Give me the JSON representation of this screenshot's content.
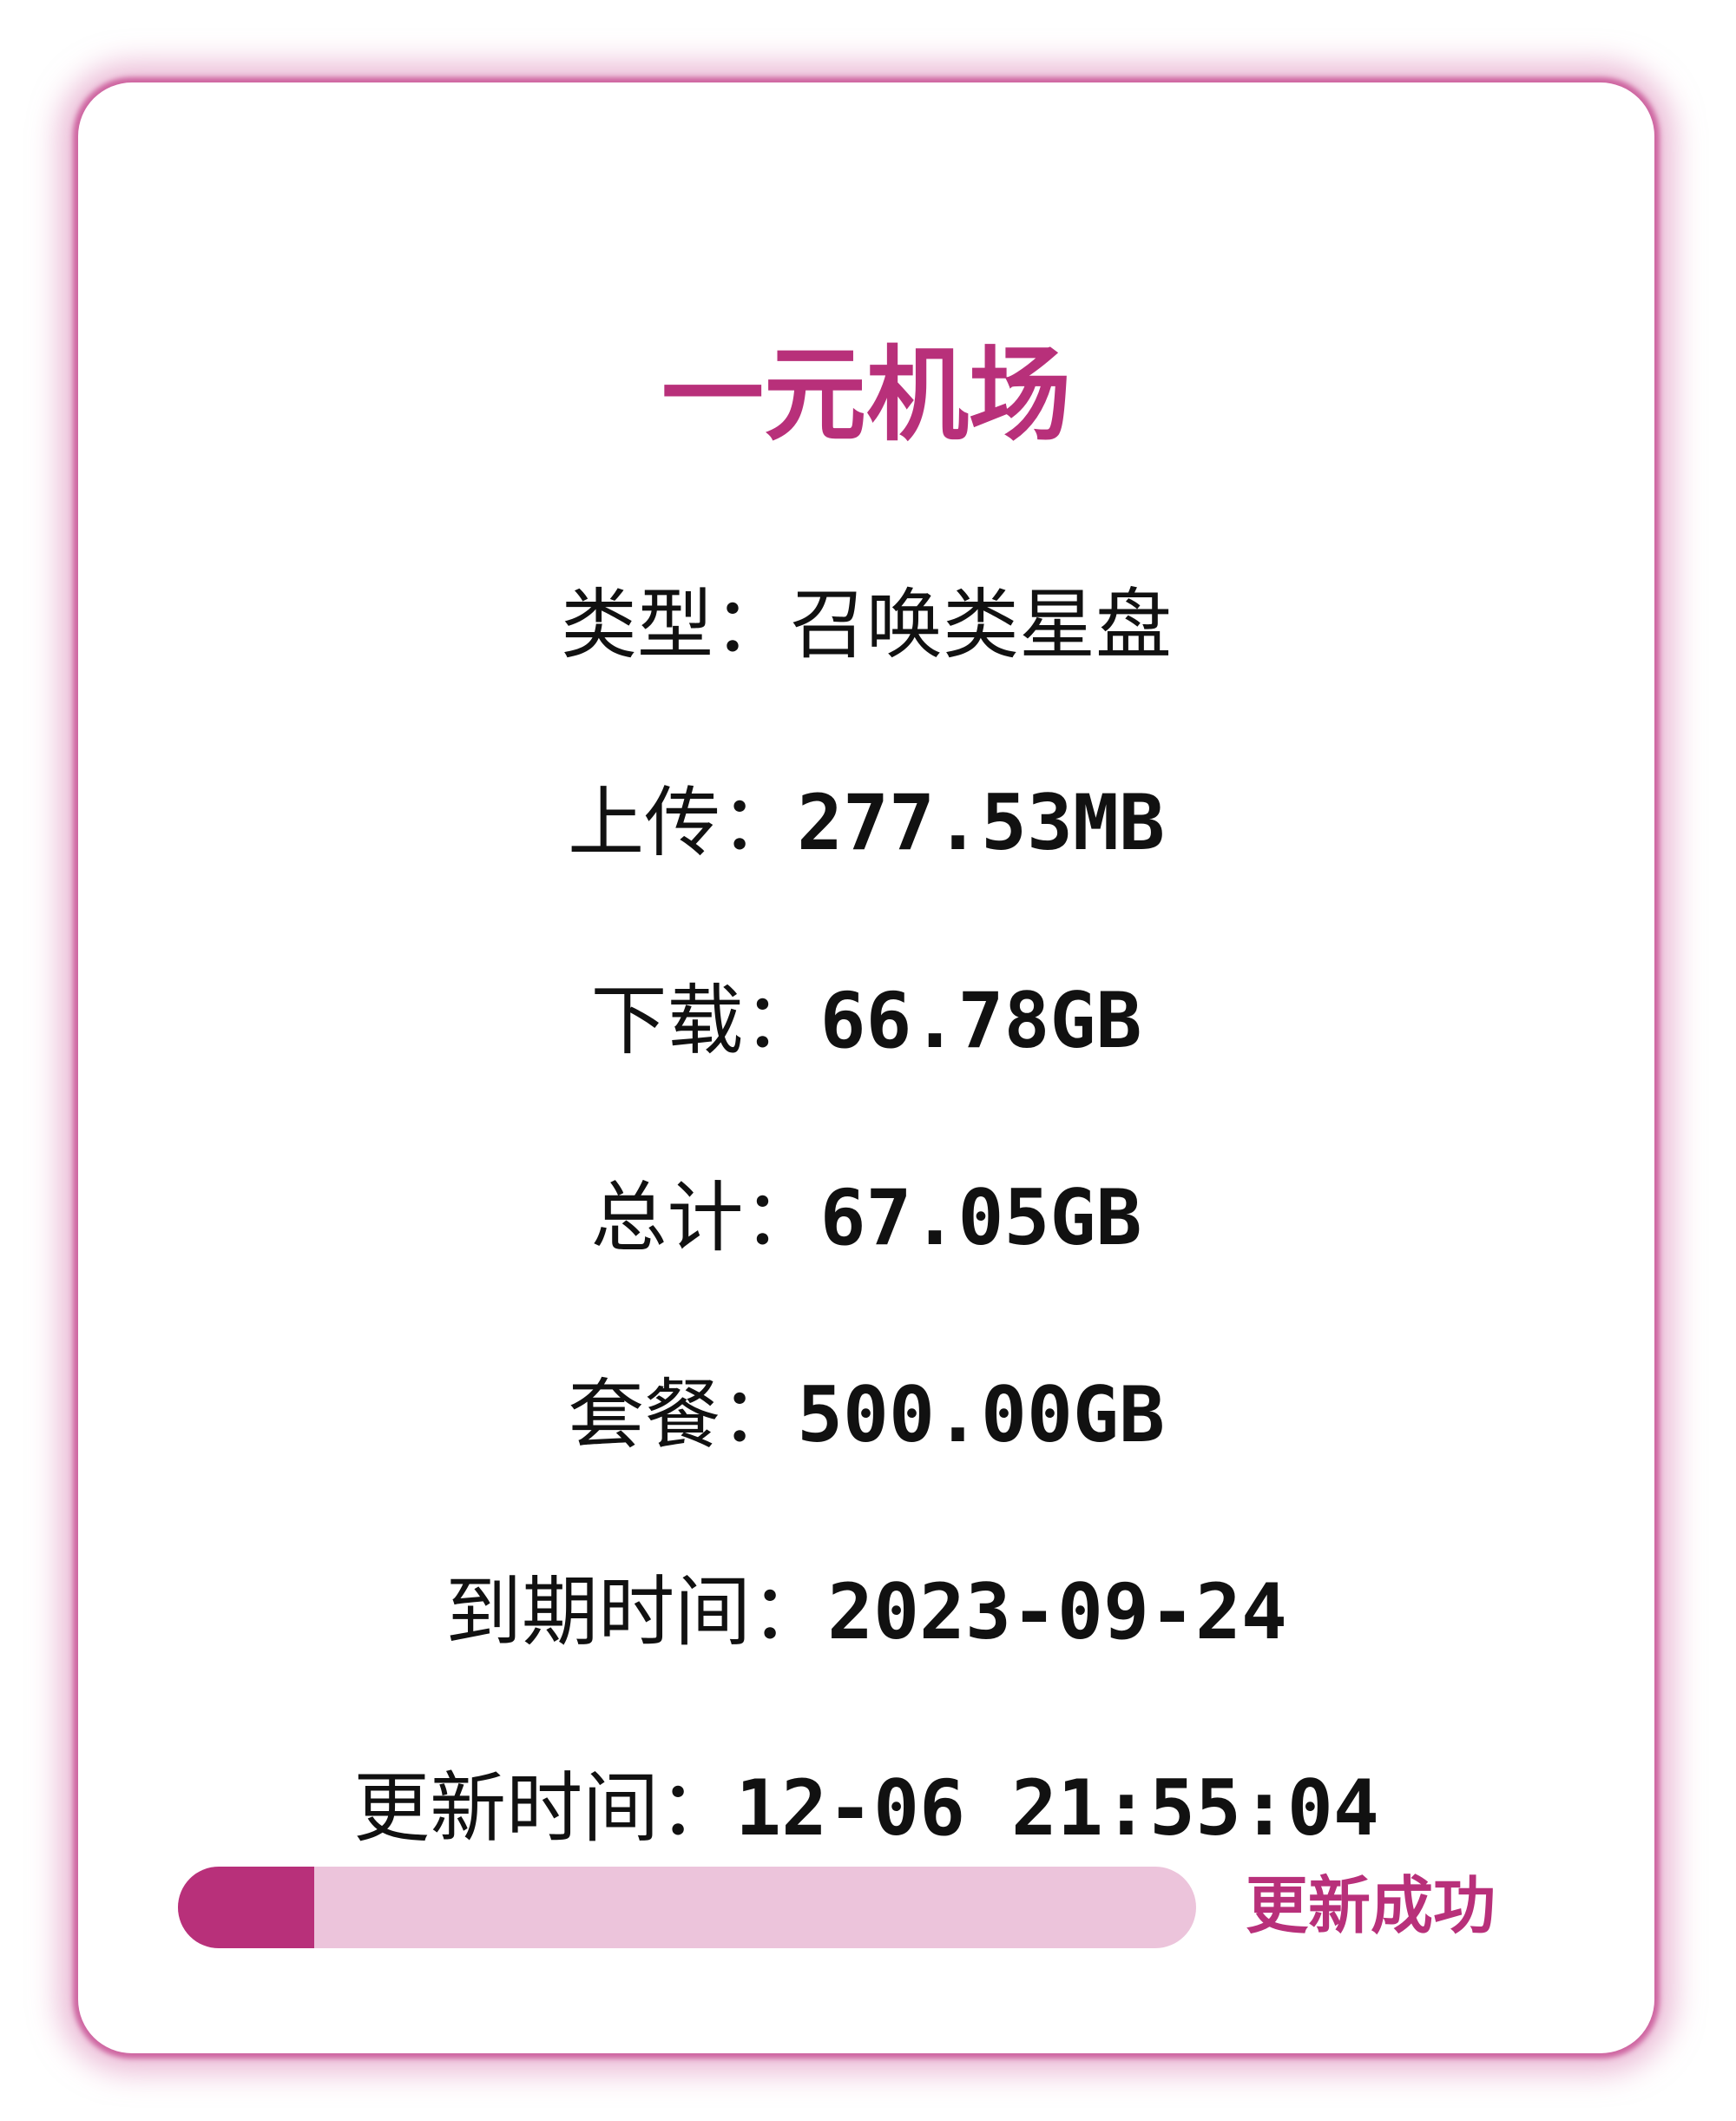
{
  "card": {
    "title": "一元机场",
    "rows": [
      {
        "label": "类型：",
        "value": "召唤类星盘"
      },
      {
        "label": "上传：",
        "value": "277.53MB"
      },
      {
        "label": "下载：",
        "value": "66.78GB"
      },
      {
        "label": "总计：",
        "value": "67.05GB"
      },
      {
        "label": "套餐：",
        "value": "500.00GB"
      },
      {
        "label": "到期时间：",
        "value": "2023-09-24"
      },
      {
        "label": "更新时间：",
        "value": "12-06 21:55:04"
      }
    ],
    "progress": {
      "fraction": 0.134,
      "status": "更新成功"
    }
  },
  "colors": {
    "accent": "#b8307a",
    "track": "#ecc4db",
    "border_glow": "#d880b2",
    "text": "#111111"
  }
}
